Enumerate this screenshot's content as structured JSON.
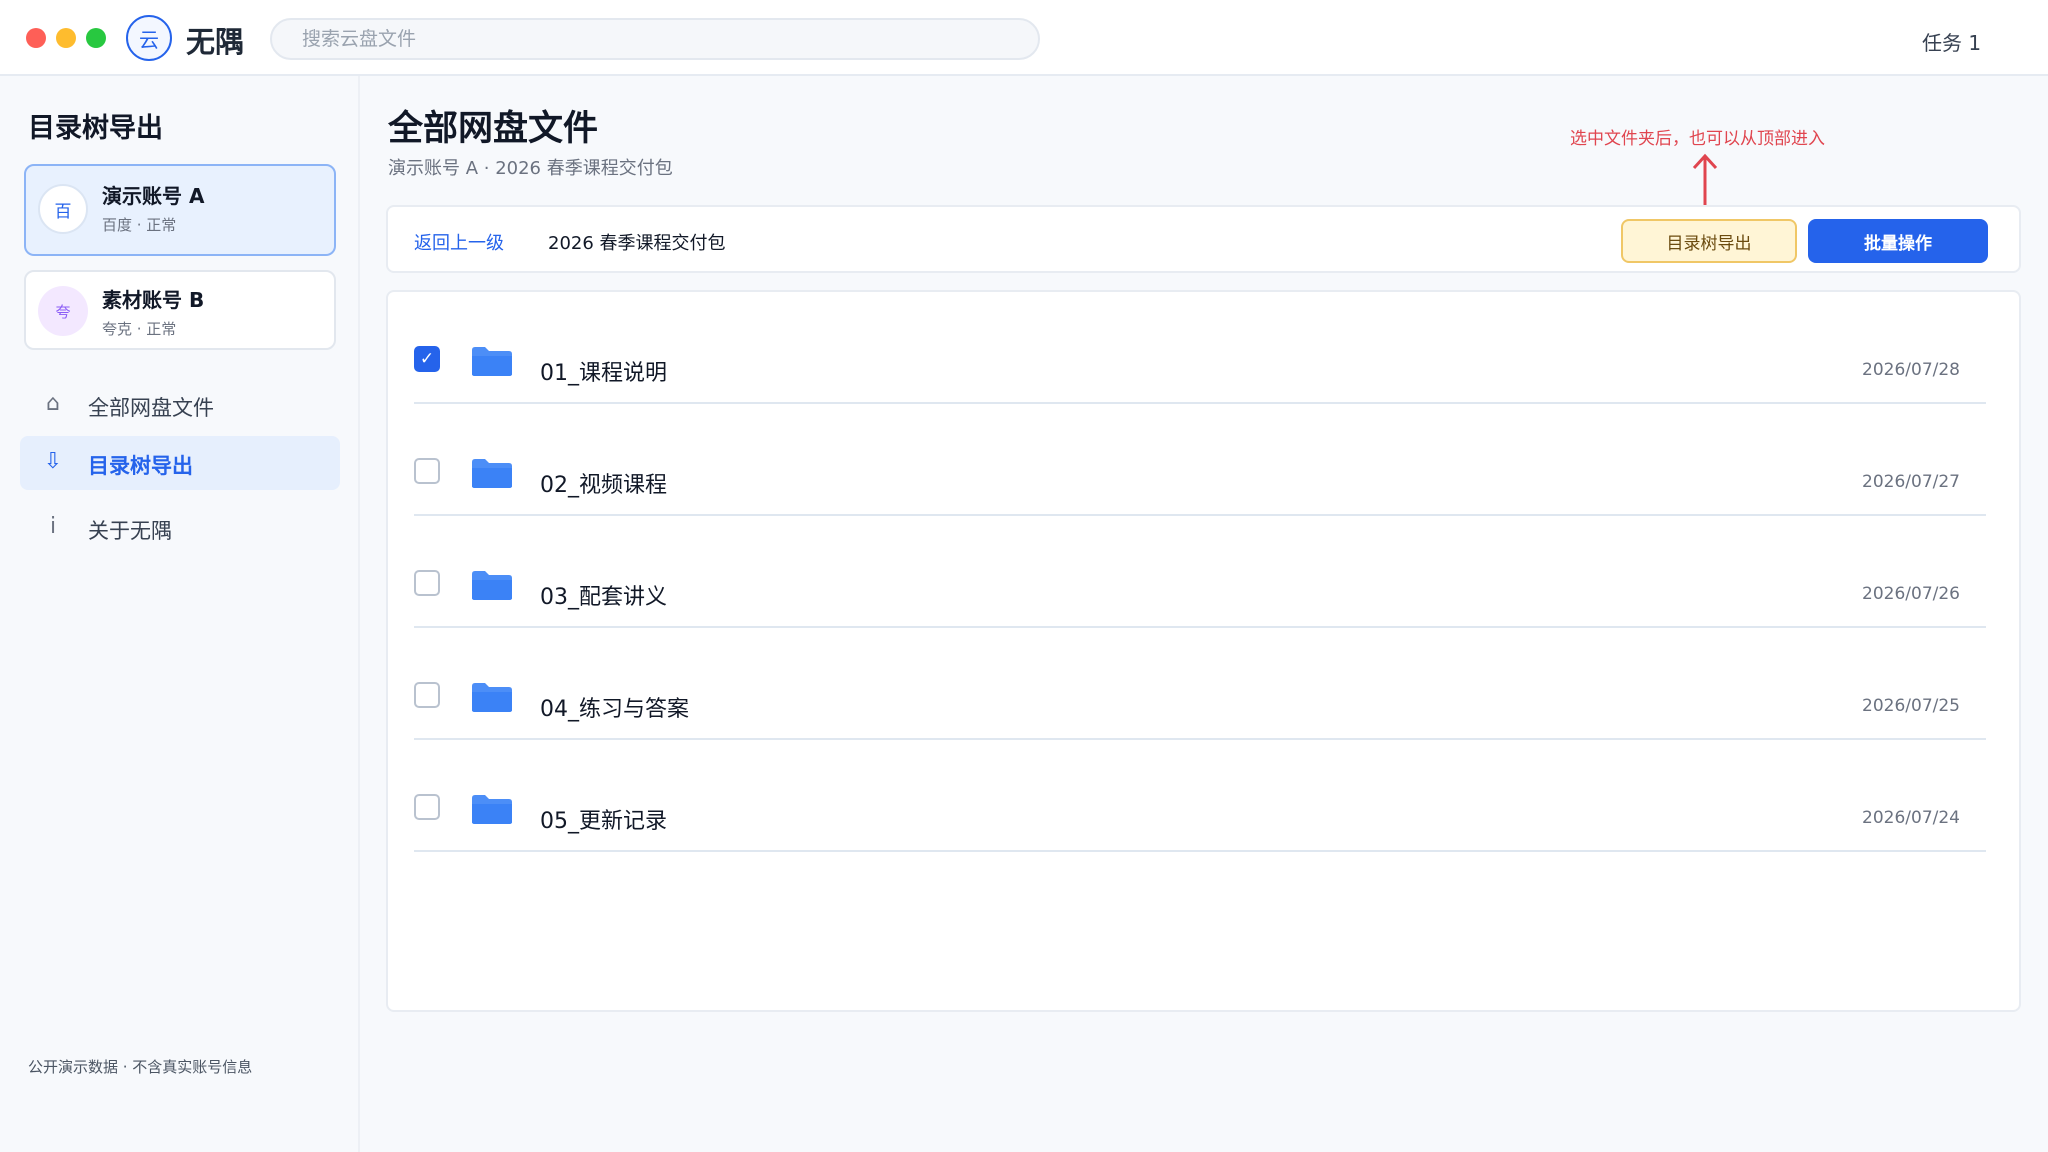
{
  "window": {
    "traffic_lights": [
      "#fe5f57",
      "#febc2e",
      "#28c840"
    ]
  },
  "topbar": {
    "logo_glyph": "云",
    "app_name": "无隅",
    "search_placeholder": "搜索云盘文件",
    "tasks_label": "任务 1"
  },
  "sidebar": {
    "title": "目录树导出",
    "accounts": [
      {
        "avatar": "百",
        "name": "演示账号 A",
        "status": "百度 · 正常",
        "active": true
      },
      {
        "avatar": "夸",
        "name": "素材账号 B",
        "status": "夸克 · 正常",
        "active": false
      }
    ],
    "nav": [
      {
        "icon": "home-icon",
        "glyph": "⌂",
        "label": "全部网盘文件",
        "active": false
      },
      {
        "icon": "download-icon",
        "glyph": "⇩",
        "label": "目录树导出",
        "active": true
      },
      {
        "icon": "info-icon",
        "glyph": "i",
        "label": "关于无隅",
        "active": false
      }
    ],
    "footer": "公开演示数据 · 不含真实账号信息"
  },
  "main": {
    "title": "全部网盘文件",
    "breadcrumb": "演示账号 A · 2026 春季课程交付包",
    "hint": "选中文件夹后，也可以从顶部进入",
    "toolbar": {
      "back_label": "返回上一级",
      "current_folder": "2026 春季课程交付包",
      "tree_export_label": "目录树导出",
      "batch_label": "批量操作"
    },
    "files": [
      {
        "name": "01_课程说明",
        "date": "2026/07/28",
        "checked": true
      },
      {
        "name": "02_视频课程",
        "date": "2026/07/27",
        "checked": false
      },
      {
        "name": "03_配套讲义",
        "date": "2026/07/26",
        "checked": false
      },
      {
        "name": "04_练习与答案",
        "date": "2026/07/25",
        "checked": false
      },
      {
        "name": "05_更新记录",
        "date": "2026/07/24",
        "checked": false
      }
    ]
  },
  "colors": {
    "accent": "#2563eb",
    "hint_red": "#e0454f",
    "folder_blue": "#4c8ef7",
    "tree_button_bg": "#fff5d6",
    "tree_button_border": "#f0c766"
  }
}
